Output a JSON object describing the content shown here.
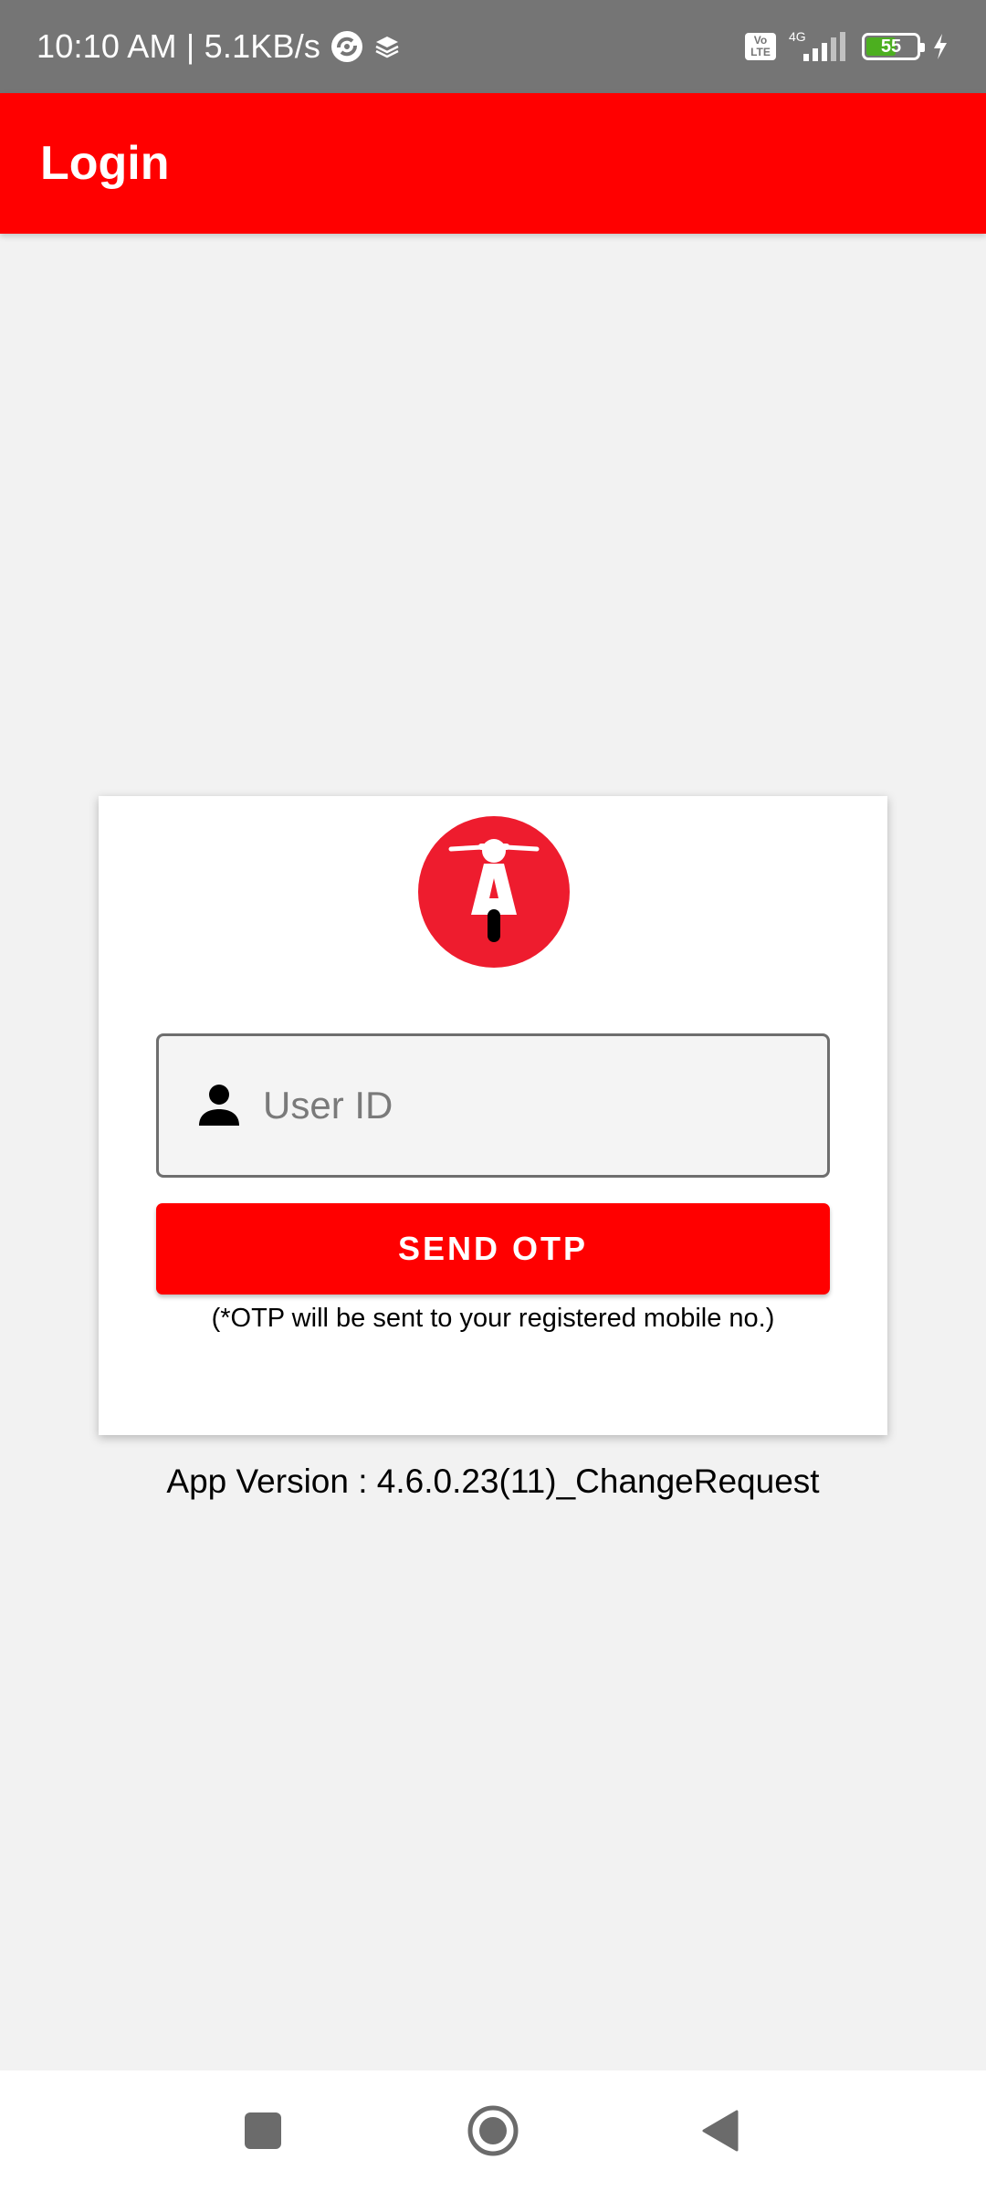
{
  "status_bar": {
    "time": "10:10 AM | 5.1KB/s",
    "volte_line1": "Vo",
    "volte_line2": "LTE",
    "network": "4G",
    "battery_level": 55,
    "battery_text": "55"
  },
  "app_bar": {
    "title": "Login"
  },
  "login_card": {
    "user_id_placeholder": "User ID",
    "user_id_value": "",
    "send_otp_label": "SEND OTP",
    "otp_note": "(*OTP will be sent to your registered mobile no.)"
  },
  "app_version": "App Version : 4.6.0.23(11)_ChangeRequest",
  "colors": {
    "primary": "#ff0000",
    "logo_red": "#ee1c2e",
    "status_bar": "#757575",
    "background": "#f2f2f2"
  },
  "icons": {
    "user_field": "person-icon",
    "nav": [
      "recents-square-icon",
      "home-circle-icon",
      "back-triangle-icon"
    ]
  }
}
